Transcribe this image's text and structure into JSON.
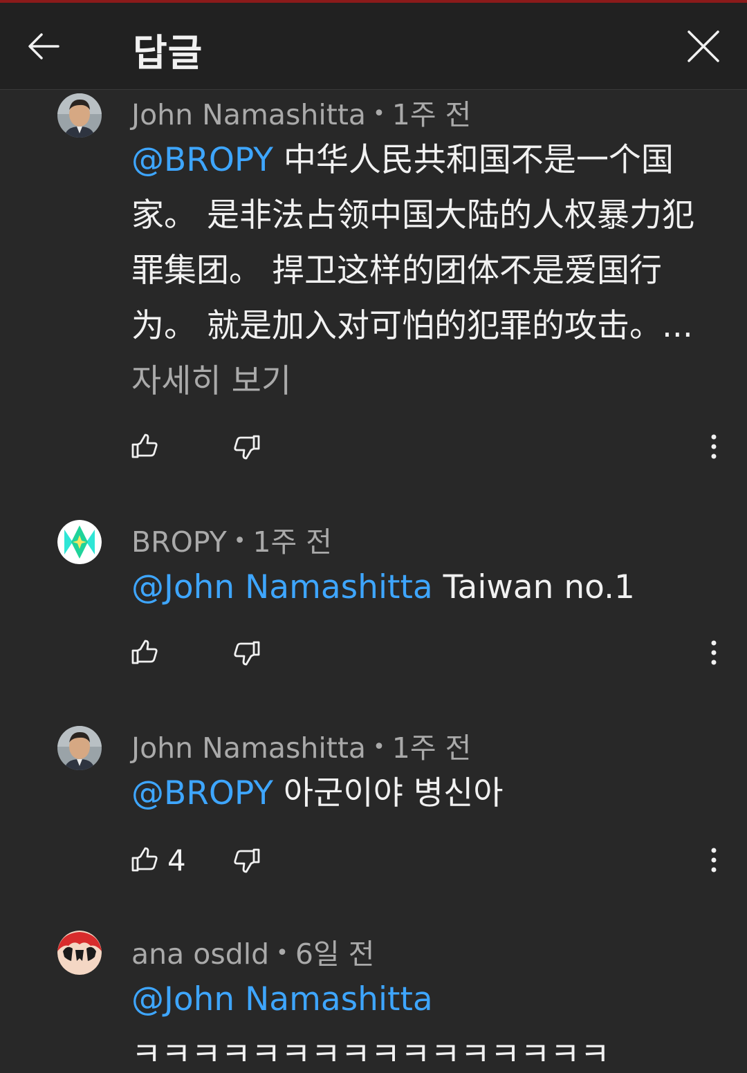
{
  "header": {
    "title": "답글",
    "back_icon": "arrow-left-icon",
    "close_icon": "close-icon"
  },
  "comments": [
    {
      "author": "John Namashitta",
      "time": "1주 전",
      "mention": "@BROPY",
      "text": " 中华人民共和国不是一个国家。 是非法占领中国大陆的人权暴力犯罪集团。 捍卫这样的团体不是爱国行为。 就是加入对可怕的犯罪的攻击。...",
      "more_label": " 자세히 보기",
      "likes": ""
    },
    {
      "author": "BROPY",
      "time": "1주 전",
      "mention": "@John Namashitta",
      "text": " Taiwan no.1",
      "likes": ""
    },
    {
      "author": "John Namashitta",
      "time": "1주 전",
      "mention": "@BROPY",
      "text": " 아군이야 병신아",
      "likes": "4"
    },
    {
      "author": "ana osdld",
      "time": "6일 전",
      "mention": "@John Namashitta",
      "text": "ㅋㅋㅋㅋㅋㅋㅋㅋㅋㅋㅋㅋㅋㅋㅋㅋ"
    }
  ],
  "icons": {
    "like": "thumbs-up-icon",
    "dislike": "thumbs-down-icon",
    "more": "more-vert-icon"
  },
  "colors": {
    "background": "#282828",
    "header": "#212121",
    "mention": "#3ea6ff",
    "meta": "#aaaaaa",
    "text": "#f1f1f1"
  }
}
